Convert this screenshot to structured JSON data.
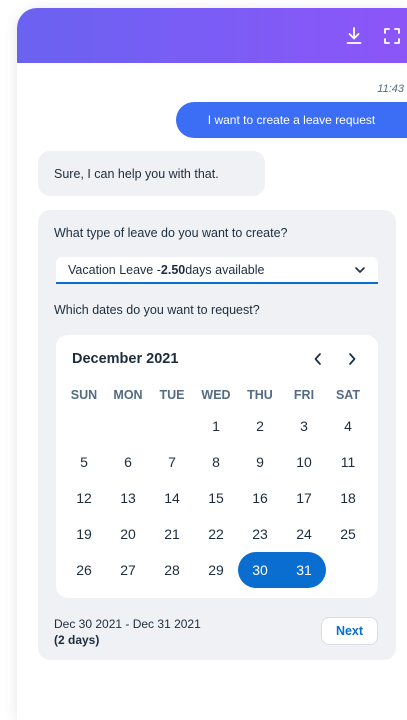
{
  "chat": {
    "timestamp": "11:43",
    "user_message": "I want to create a leave request",
    "bot_message": "Sure, I can help you with that."
  },
  "form": {
    "question_type": "What type of leave do you want to create?",
    "leave_select": {
      "prefix": "Vacation Leave - ",
      "amount": "2.50",
      "suffix": " days available"
    },
    "question_dates": "Which dates do you want to request?"
  },
  "calendar": {
    "month_label": "December 2021",
    "weekdays": [
      "SUN",
      "MON",
      "TUE",
      "WED",
      "THU",
      "FRI",
      "SAT"
    ],
    "weeks": [
      [
        "",
        "",
        "",
        "1",
        "2",
        "3",
        "4"
      ],
      [
        "5",
        "6",
        "7",
        "8",
        "9",
        "10",
        "11"
      ],
      [
        "12",
        "13",
        "14",
        "15",
        "16",
        "17",
        "18"
      ],
      [
        "19",
        "20",
        "21",
        "22",
        "23",
        "24",
        "25"
      ],
      [
        "26",
        "27",
        "28",
        "29",
        "30",
        "31",
        ""
      ]
    ],
    "selected_days": [
      "30",
      "31"
    ]
  },
  "selection": {
    "range_label": "Dec 30 2021 - Dec 31 2021",
    "days_label": "(2 days)"
  },
  "actions": {
    "next_label": "Next"
  },
  "colors": {
    "header_gradient_start": "#6a62f0",
    "header_gradient_end": "#8c55f8",
    "accent": "#0a6ed1",
    "user_bubble": "#3b6ef5",
    "panel_bg": "#eff1f4"
  },
  "icons": {
    "header": [
      "download-icon",
      "fullscreen-icon"
    ],
    "select": "chevron-down-icon",
    "calendar_nav": [
      "chevron-left-icon",
      "chevron-right-icon"
    ]
  }
}
